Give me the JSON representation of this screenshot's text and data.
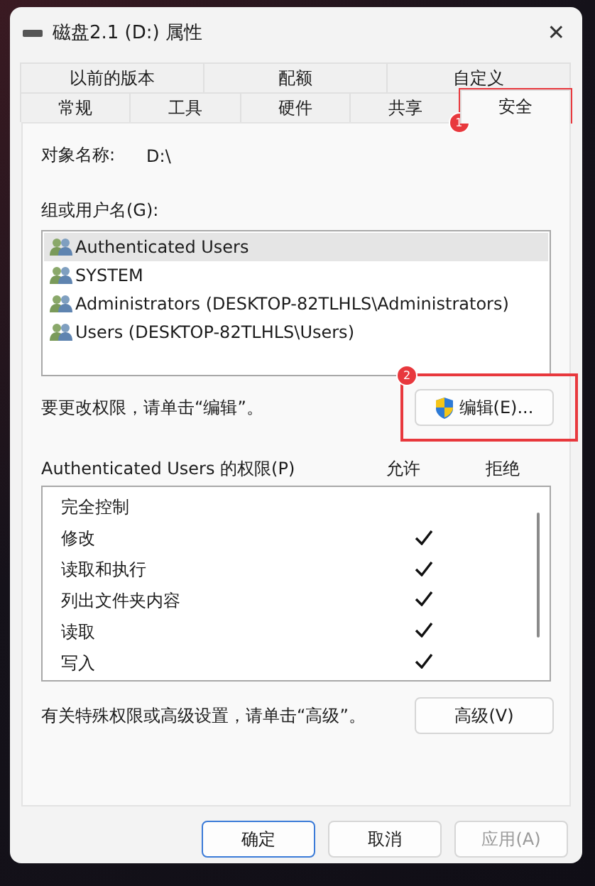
{
  "window": {
    "title": "磁盘2.1 (D:) 属性",
    "close": "✕"
  },
  "tabs": [
    [
      {
        "label": "以前的版本",
        "selected": false
      },
      {
        "label": "配额",
        "selected": false
      },
      {
        "label": "自定义",
        "selected": false
      }
    ],
    [
      {
        "label": "常规",
        "selected": false
      },
      {
        "label": "工具",
        "selected": false
      },
      {
        "label": "硬件",
        "selected": false
      },
      {
        "label": "共享",
        "selected": false
      },
      {
        "label": "安全",
        "selected": true,
        "annotation": "1"
      }
    ]
  ],
  "object_name": {
    "label": "对象名称:",
    "value": "D:\\"
  },
  "groups": {
    "label": "组或用户名(G):",
    "items": [
      {
        "name": "Authenticated Users",
        "selected": true
      },
      {
        "name": "SYSTEM",
        "selected": false
      },
      {
        "name": "Administrators (DESKTOP-82TLHLS\\Administrators)",
        "selected": false
      },
      {
        "name": "Users (DESKTOP-82TLHLS\\Users)",
        "selected": false
      }
    ]
  },
  "edit_hint": "要更改权限，请单击“编辑”。",
  "edit_button": {
    "label": "编辑(E)...",
    "annotation": "2"
  },
  "permissions": {
    "label": "Authenticated Users 的权限(P)",
    "allow_header": "允许",
    "deny_header": "拒绝",
    "rows": [
      {
        "name": "完全控制",
        "allow": false
      },
      {
        "name": "修改",
        "allow": true
      },
      {
        "name": "读取和执行",
        "allow": true
      },
      {
        "name": "列出文件夹内容",
        "allow": true
      },
      {
        "name": "读取",
        "allow": true
      },
      {
        "name": "写入",
        "allow": true
      }
    ]
  },
  "advanced_hint": "有关特殊权限或高级设置，请单击“高级”。",
  "advanced_button": "高级(V)",
  "buttons": [
    {
      "label": "确定",
      "default": true,
      "disabled": false
    },
    {
      "label": "取消",
      "default": false,
      "disabled": false
    },
    {
      "label": "应用(A)",
      "default": false,
      "disabled": true
    }
  ]
}
